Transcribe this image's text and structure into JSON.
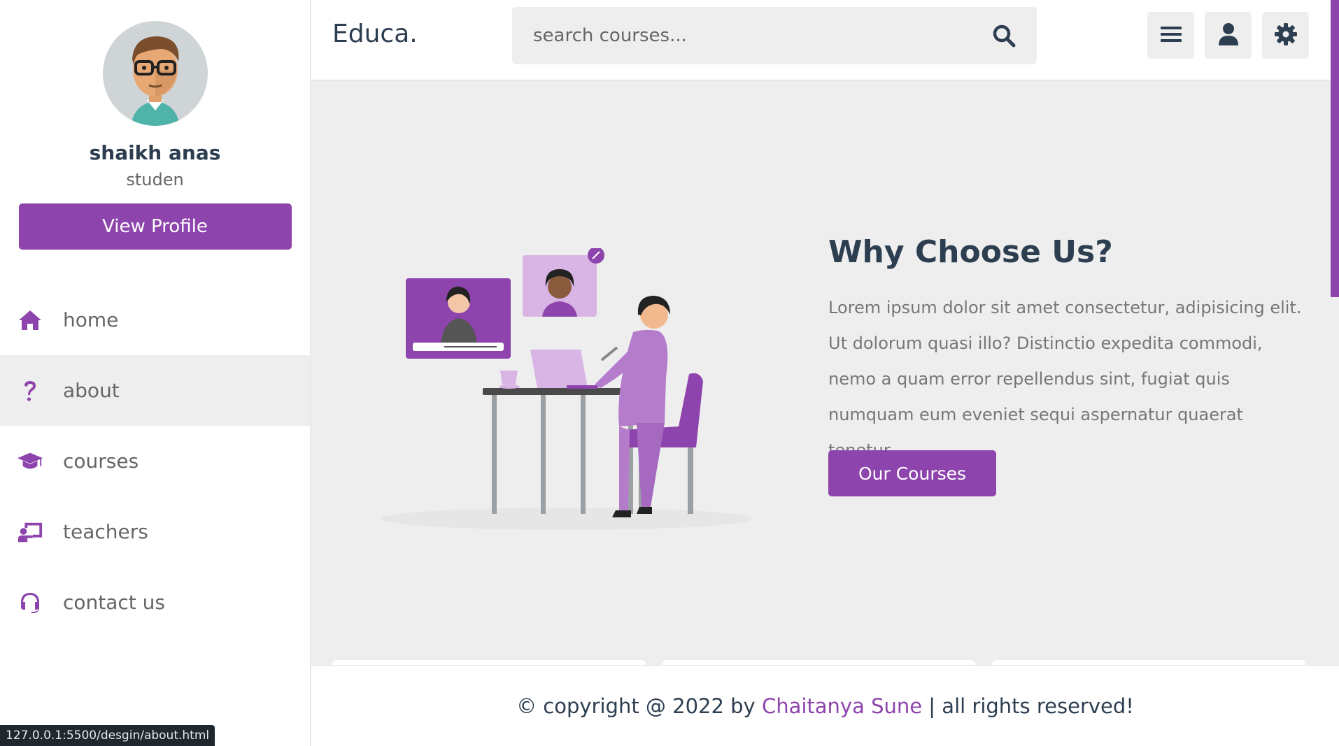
{
  "sidebar": {
    "user_name": "shaikh anas",
    "user_role": "studen",
    "view_profile_label": "View Profile",
    "nav": [
      {
        "label": "home",
        "icon": "home-icon",
        "active": false
      },
      {
        "label": "about",
        "icon": "question-icon",
        "active": true
      },
      {
        "label": "courses",
        "icon": "graduation-cap-icon",
        "active": false
      },
      {
        "label": "teachers",
        "icon": "chalkboard-teacher-icon",
        "active": false
      },
      {
        "label": "contact us",
        "icon": "headset-icon",
        "active": false
      }
    ]
  },
  "header": {
    "logo": "Educa.",
    "search_placeholder": "search courses...",
    "buttons": [
      "menu-icon",
      "user-icon",
      "gear-icon"
    ]
  },
  "about": {
    "title": "Why Choose Us?",
    "text": "Lorem ipsum dolor sit amet consectetur, adipisicing elit. Ut dolorum quasi illo? Distinctio expedita commodi, nemo a quam error repellendus sint, fugiat quis numquam eum eveniet sequi aspernatur quaerat tenetur.",
    "button_label": "Our Courses"
  },
  "footer": {
    "prefix": "© copyright @ 2022 by ",
    "author": "Chaitanya Sune",
    "suffix": " | all rights reserved!"
  },
  "status_bar": {
    "url": "127.0.0.1:5500/desgin/about.html"
  },
  "colors": {
    "accent": "#8e44ad",
    "text_dark": "#2c3e50",
    "background": "#eeeeee"
  }
}
